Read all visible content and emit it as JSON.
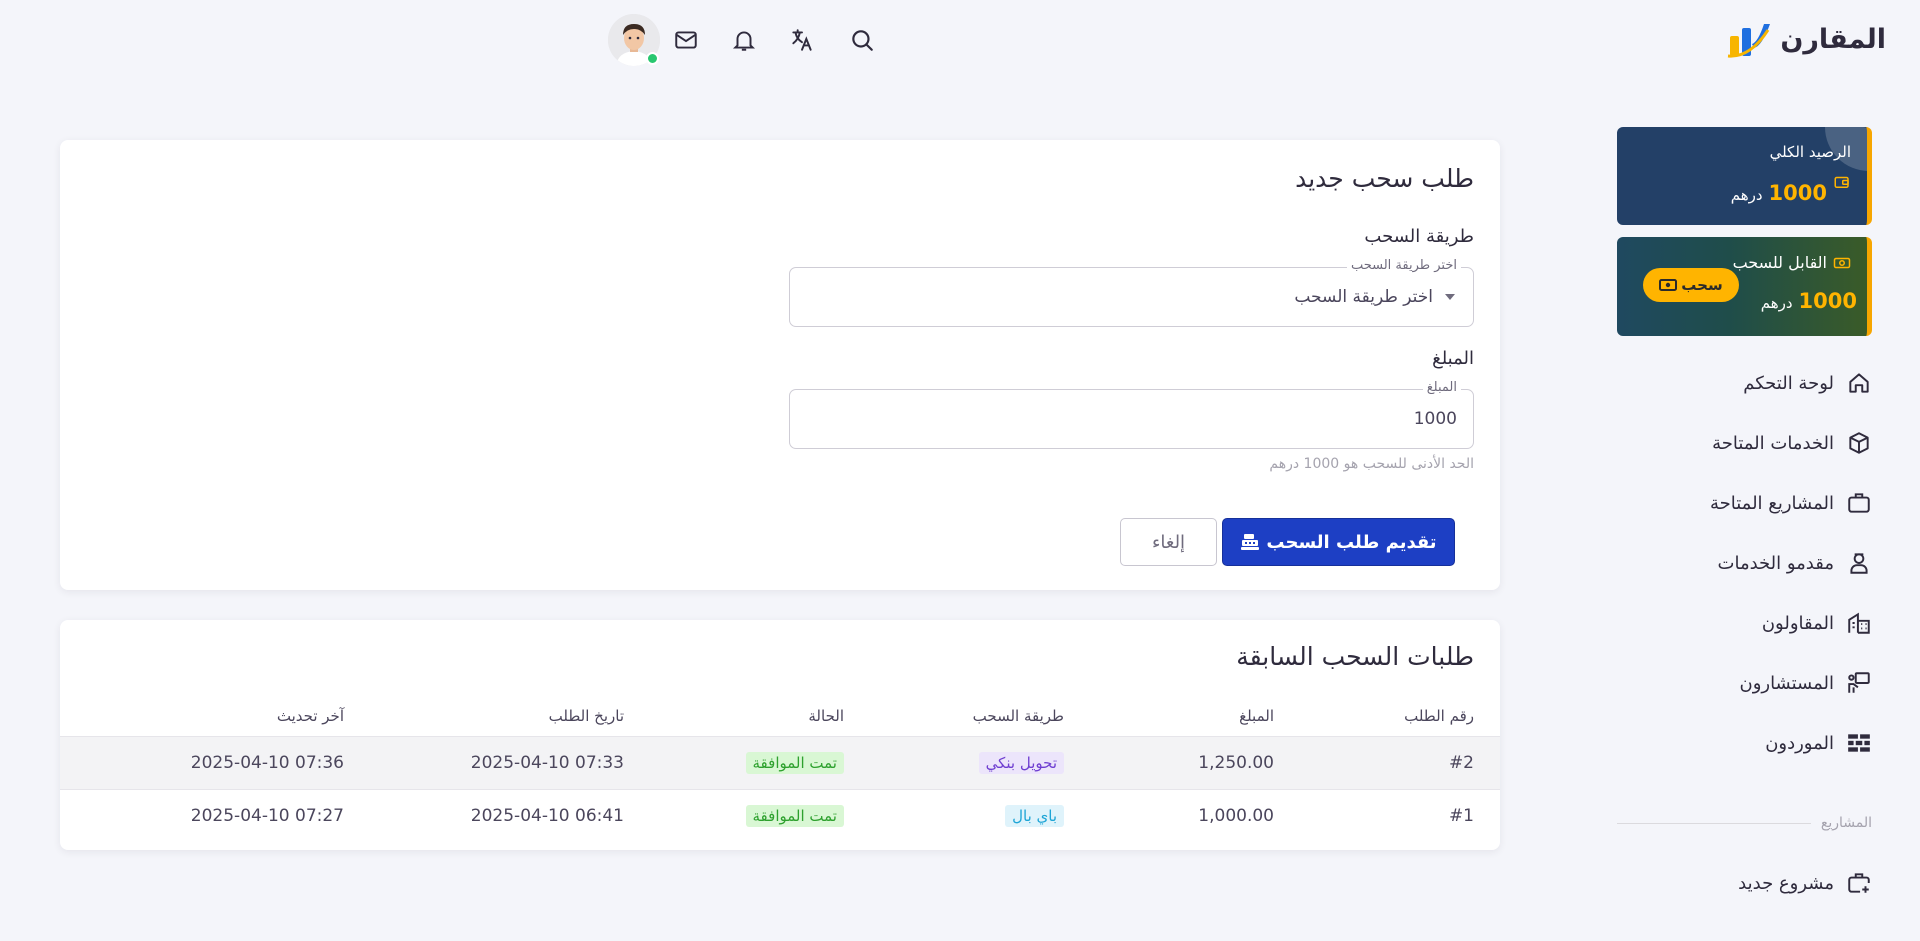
{
  "brand": {
    "name": "المقارن"
  },
  "wallet": {
    "total": {
      "title": "الرصيد الكلي",
      "amount": "1000",
      "currency": "درهم"
    },
    "available": {
      "title": "القابل للسحب",
      "amount": "1000",
      "currency": "درهم",
      "button_label": "سحب"
    }
  },
  "nav": {
    "items": [
      {
        "label": "لوحة التحكم",
        "icon": "home-icon"
      },
      {
        "label": "الخدمات المتاحة",
        "icon": "box-icon"
      },
      {
        "label": "المشاريع المتاحة",
        "icon": "briefcase-icon"
      },
      {
        "label": "مقدمو الخدمات",
        "icon": "service-provider-icon"
      },
      {
        "label": "المقاولون",
        "icon": "building-icon"
      },
      {
        "label": "المستشارون",
        "icon": "presentation-icon"
      },
      {
        "label": "الموردون",
        "icon": "bricks-icon"
      }
    ],
    "section_title": "المشاريع",
    "section_items": [
      {
        "label": "مشروع جديد",
        "icon": "briefcase-plus-icon"
      }
    ]
  },
  "form": {
    "title": "طلب سحب جديد",
    "method_label": "طريقة السحب",
    "method_legend": "اختر طريقة السحب",
    "method_value": "اختر طريقة السحب",
    "amount_label": "المبلغ",
    "amount_legend": "المبلغ",
    "amount_value": "1000",
    "helper": "الحد الأدنى للسحب هو 1000 درهم",
    "submit_label": "تقديم طلب السحب",
    "cancel_label": "إلغاء"
  },
  "history": {
    "title": "طلبات السحب السابقة",
    "columns": {
      "id": "رقم الطلب",
      "amount": "المبلغ",
      "method": "طريقة السحب",
      "status": "الحالة",
      "requested": "تاريخ الطلب",
      "updated": "آخر تحديث"
    },
    "rows": [
      {
        "id": "#2",
        "amount": "1,250.00",
        "method": "تحويل بنكي",
        "status": "تمت الموافقة",
        "requested": "2025-04-10 07:33",
        "updated": "2025-04-10 07:36"
      },
      {
        "id": "#1",
        "amount": "1,000.00",
        "method": "باي بال",
        "status": "تمت الموافقة",
        "requested": "2025-04-10 06:41",
        "updated": "2025-04-10 07:27"
      }
    ]
  },
  "colors": {
    "primary": "#1d3fc4",
    "wallet_total_bg": "#234067",
    "accent": "#ffb400",
    "success": "#2ea12e"
  }
}
